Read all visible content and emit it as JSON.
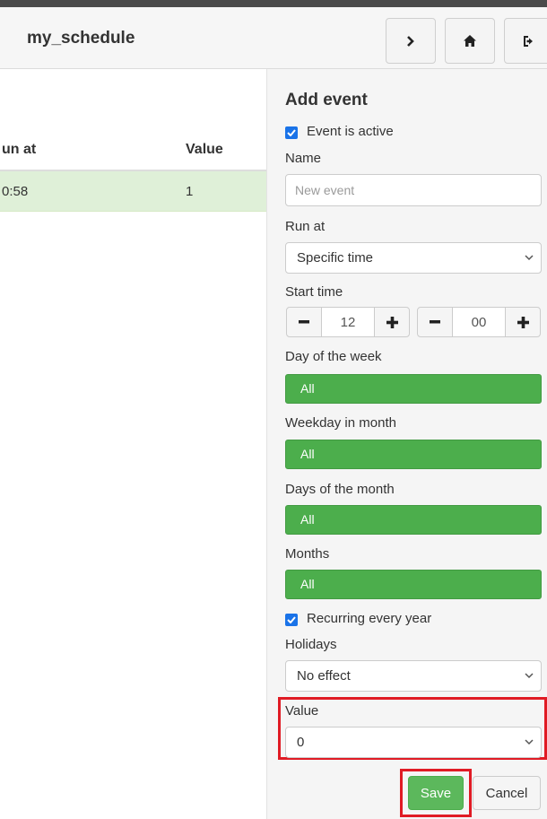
{
  "header": {
    "title": "my_schedule"
  },
  "table": {
    "columns": [
      "Run at",
      "Value"
    ],
    "column_visible": [
      "un at",
      "Value"
    ],
    "rows": [
      {
        "run_at": "0:58",
        "value": "1"
      }
    ]
  },
  "form": {
    "title": "Add event",
    "event_active_label": "Event is active",
    "event_active_checked": true,
    "name_label": "Name",
    "name_placeholder": "New event",
    "name_value": "",
    "run_at_label": "Run at",
    "run_at_value": "Specific time",
    "start_time_label": "Start time",
    "hour": "12",
    "minute": "00",
    "day_of_week_label": "Day of the week",
    "day_of_week_value": "All",
    "weekday_in_month_label": "Weekday in month",
    "weekday_in_month_value": "All",
    "days_of_month_label": "Days of the month",
    "days_of_month_value": "All",
    "months_label": "Months",
    "months_value": "All",
    "recurring_label": "Recurring every year",
    "recurring_checked": true,
    "holidays_label": "Holidays",
    "holidays_value": "No effect",
    "value_label": "Value",
    "value_value": "0",
    "save_label": "Save",
    "cancel_label": "Cancel"
  },
  "colors": {
    "highlight": "#e01b24",
    "selected_row": "#dff0d8",
    "green_bar": "#4cae4c",
    "checkbox": "#1a73e8"
  }
}
